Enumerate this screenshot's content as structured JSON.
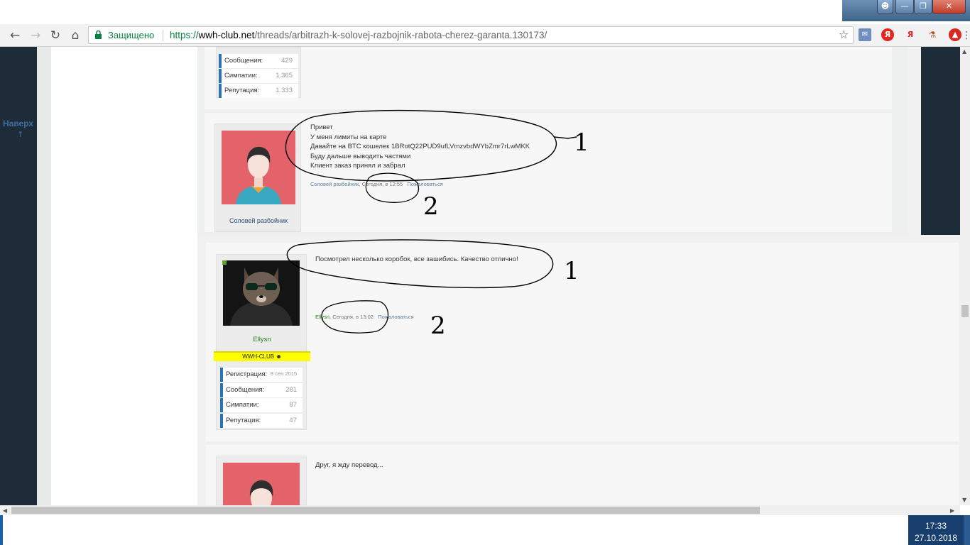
{
  "toolbar": {
    "secure_label": "Защищено",
    "url_scheme": "https://",
    "url_host": "wwh-club.net",
    "url_path": "/threads/arbitrazh-k-solovej-razbojnik-rabota-cherez-garanta.130173/",
    "extensions": {
      "yandex1": "Я",
      "yandex2": "Я"
    }
  },
  "sidebar": {
    "nav_top": "Наверх",
    "nav_top_sub": "↑"
  },
  "posts": {
    "first_stats": [
      {
        "label": "Сообщения:",
        "value": "429"
      },
      {
        "label": "Симпатии:",
        "value": "1.365"
      },
      {
        "label": "Репутация:",
        "value": "1.333"
      }
    ],
    "solovey": {
      "username": "Соловей разбойник",
      "lines": [
        "Привет",
        "У меня лимиты на карте",
        "Давайте на BTC кошелек 1BRotQ22PUD9ufLVmzvbdWYbZmr7rLwMKK",
        "Буду дальше выводить частями",
        "Клиент заказ принял и забрал"
      ],
      "meta_author": "Соловей разбойник",
      "meta_time": "Сегодня, в 12:55",
      "meta_report": "Пожаловаться"
    },
    "ellysn": {
      "username": "Ellysn",
      "badge": "WWH-CLUB",
      "message": "Посмотрел несколько коробок, все зашибись. Качество отлично!",
      "meta_author": "Ellysn",
      "meta_time": "Сегодня, в 13:02",
      "meta_report": "Пожаловаться",
      "stats": [
        {
          "label": "Регистрация:",
          "value": "9 сен 2015"
        },
        {
          "label": "Сообщения:",
          "value": "281"
        },
        {
          "label": "Симпатии:",
          "value": "87"
        },
        {
          "label": "Репутация:",
          "value": "47"
        }
      ]
    },
    "third": {
      "message": "Друг, я жду перевод..."
    }
  },
  "annotations": {
    "one_a": "1",
    "two_a": "2",
    "one_b": "1",
    "two_b": "2"
  },
  "taskbar": {
    "time": "17:33",
    "date": "27.10.2018"
  },
  "colors": {
    "accent_green": "#0b8043",
    "badge_yellow": "#ffff00",
    "sidebar_dark": "#1e2b38",
    "stat_blue": "#2b74b0"
  }
}
